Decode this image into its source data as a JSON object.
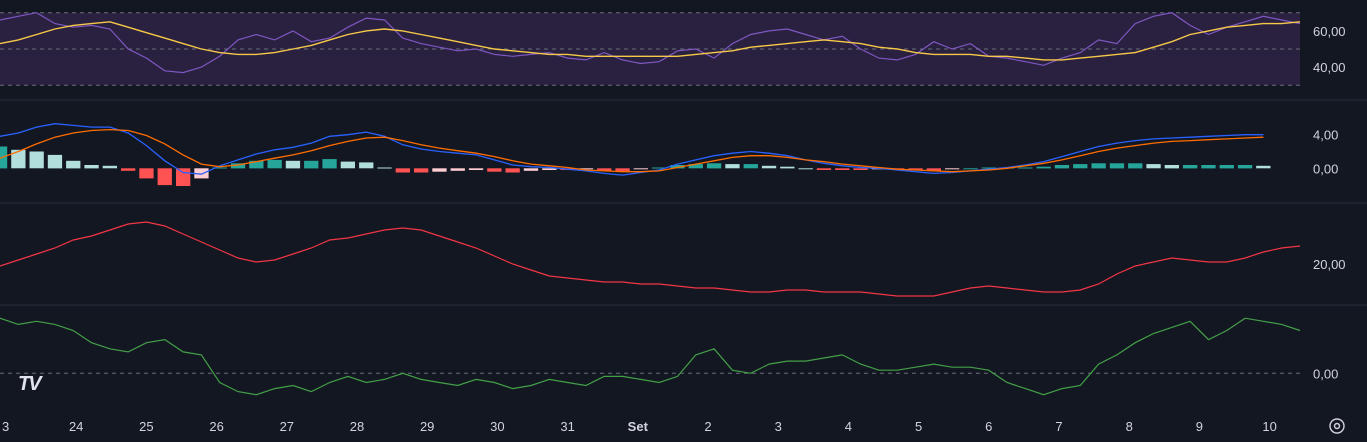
{
  "colors": {
    "background": "#131722",
    "rsi_band": "#2a2140",
    "rsi_line": "#7e57c2",
    "rsi_ma": "#f7c948",
    "macd_line": "#2962ff",
    "signal_line": "#ff6d00",
    "hist_pos_strong": "#26a69a",
    "hist_pos_weak": "#b2dfdb",
    "hist_neg_strong": "#ff5252",
    "hist_neg_weak": "#ffcdd2",
    "adx_line": "#f23645",
    "mom_line": "#43a047",
    "grid": "#1f2330",
    "dashed": "#6b6f7a"
  },
  "logo_text": "TV",
  "settings_icon": "gear-icon",
  "chart_data": [
    {
      "type": "line",
      "panel": "rsi",
      "y_ticks": [
        "60,00",
        "40,00"
      ],
      "ylim": [
        23,
        77
      ],
      "bands": [
        30,
        50,
        70
      ],
      "series": [
        {
          "values": [
            66,
            68,
            70,
            64,
            62,
            63,
            61,
            50,
            45,
            38,
            37,
            40,
            46,
            55,
            58,
            55,
            60,
            54,
            56,
            62,
            67,
            66,
            56,
            53,
            51,
            49,
            50,
            47,
            46,
            47,
            48,
            45,
            44,
            48,
            44,
            42,
            43,
            49,
            50,
            45,
            53,
            58,
            60,
            61,
            58,
            55,
            57,
            50,
            45,
            44,
            47,
            54,
            50,
            53,
            46,
            45,
            43,
            41,
            45,
            48,
            55,
            53,
            64,
            68,
            70,
            63,
            58,
            62,
            65,
            68,
            66,
            64
          ]
        },
        {
          "values": [
            53,
            55,
            58,
            61,
            63,
            64,
            65,
            62,
            59,
            56,
            53,
            50,
            48,
            47,
            47,
            48,
            50,
            52,
            55,
            58,
            60,
            61,
            60,
            58,
            56,
            54,
            52,
            50,
            49,
            48,
            47,
            47,
            46,
            46,
            46,
            46,
            46,
            46,
            47,
            48,
            49,
            51,
            52,
            53,
            54,
            55,
            54,
            53,
            51,
            50,
            48,
            47,
            47,
            47,
            46,
            46,
            45,
            44,
            44,
            45,
            46,
            47,
            48,
            51,
            54,
            58,
            60,
            62,
            63,
            64,
            64,
            65
          ]
        }
      ]
    },
    {
      "type": "bar",
      "panel": "macd",
      "y_ticks": [
        "4,00",
        "0,00"
      ],
      "ylim": [
        -4,
        8
      ],
      "series": [
        {
          "values": [
            3.8,
            4.2,
            4.9,
            5.3,
            5.1,
            4.9,
            4.9,
            4.2,
            2.7,
            0.9,
            -0.5,
            -0.7,
            0.3,
            1.0,
            1.7,
            2.2,
            2.5,
            3.0,
            3.8,
            4.0,
            4.3,
            3.8,
            2.8,
            2.3,
            2.0,
            1.8,
            1.6,
            1.0,
            0.4,
            0.2,
            0.1,
            -0.1,
            -0.3,
            -0.6,
            -0.8,
            -0.5,
            -0.2,
            0.5,
            1.0,
            1.5,
            1.8,
            2.0,
            1.8,
            1.5,
            1.0,
            0.6,
            0.3,
            0.1,
            0.0,
            -0.2,
            -0.4,
            -0.6,
            -0.5,
            -0.3,
            -0.1,
            0.1,
            0.4,
            0.8,
            1.4,
            2.0,
            2.6,
            3.0,
            3.3,
            3.5,
            3.6,
            3.7,
            3.8,
            3.9,
            4.0,
            4.0
          ]
        },
        {
          "values": [
            1.2,
            2.0,
            2.9,
            3.7,
            4.2,
            4.5,
            4.6,
            4.5,
            3.9,
            2.9,
            1.6,
            0.5,
            0.2,
            0.4,
            0.8,
            1.2,
            1.6,
            2.1,
            2.7,
            3.2,
            3.6,
            3.7,
            3.3,
            2.8,
            2.4,
            2.1,
            1.8,
            1.4,
            0.9,
            0.5,
            0.3,
            0.1,
            -0.2,
            -0.3,
            -0.4,
            -0.4,
            -0.3,
            0.1,
            0.5,
            0.9,
            1.3,
            1.5,
            1.5,
            1.3,
            1.0,
            0.8,
            0.5,
            0.3,
            0.1,
            -0.1,
            -0.2,
            -0.3,
            -0.4,
            -0.3,
            -0.2,
            0.0,
            0.3,
            0.6,
            1.0,
            1.5,
            2.0,
            2.4,
            2.7,
            3.0,
            3.2,
            3.3,
            3.4,
            3.5,
            3.6,
            3.7
          ]
        },
        {
          "values": [
            2.6,
            2.2,
            2.0,
            1.6,
            0.9,
            0.4,
            0.3,
            -0.3,
            -1.2,
            -2.0,
            -2.1,
            -1.2,
            0.1,
            0.6,
            0.9,
            1.0,
            0.9,
            0.9,
            1.1,
            0.8,
            0.7,
            0.1,
            -0.5,
            -0.5,
            -0.4,
            -0.3,
            -0.2,
            -0.4,
            -0.5,
            -0.3,
            -0.2,
            -0.2,
            -0.1,
            -0.3,
            -0.4,
            -0.1,
            0.1,
            0.4,
            0.5,
            0.6,
            0.5,
            0.5,
            0.3,
            0.2,
            0.0,
            -0.2,
            -0.2,
            -0.2,
            -0.1,
            -0.1,
            -0.2,
            -0.3,
            -0.1,
            0.0,
            0.1,
            0.1,
            0.1,
            0.2,
            0.4,
            0.5,
            0.6,
            0.6,
            0.6,
            0.5,
            0.4,
            0.4,
            0.4,
            0.4,
            0.4,
            0.3
          ]
        }
      ]
    },
    {
      "type": "line",
      "panel": "adx",
      "y_ticks": [
        "20,00"
      ],
      "ylim": [
        10,
        35
      ],
      "series": [
        {
          "values": [
            19.5,
            21,
            22.5,
            24,
            26,
            27,
            28.5,
            30,
            30.5,
            29.5,
            27.5,
            25.5,
            23.5,
            21.5,
            20.5,
            21,
            22.5,
            24,
            26,
            26.5,
            27.5,
            28.5,
            29,
            28.5,
            27,
            25.5,
            24,
            22,
            20,
            18.5,
            17,
            16.5,
            16,
            15.5,
            15.5,
            15,
            15,
            14.5,
            14,
            14,
            13.5,
            13,
            13,
            13.5,
            13.5,
            13,
            13,
            13,
            12.5,
            12,
            12,
            12,
            13,
            14,
            14.5,
            14,
            13.5,
            13,
            13,
            13.5,
            15,
            17.5,
            19.5,
            20.5,
            21.5,
            21,
            20.5,
            20.5,
            21.5,
            23,
            24,
            24.5
          ]
        }
      ]
    },
    {
      "type": "line",
      "panel": "momentum",
      "y_ticks": [
        "0,00"
      ],
      "ylim": [
        -12,
        22
      ],
      "series": [
        {
          "values": [
            18,
            16,
            17,
            16,
            14,
            10,
            8,
            7,
            10,
            11,
            7,
            6,
            -3,
            -6,
            -7,
            -5,
            -4,
            -6,
            -3,
            -1,
            -3,
            -2,
            0,
            -2,
            -3,
            -4,
            -2,
            -3,
            -5,
            -4,
            -2,
            -3,
            -4,
            -1,
            -1,
            -2,
            -3,
            -1,
            6,
            8,
            1,
            0,
            3,
            4,
            4,
            5,
            6,
            3,
            1,
            1,
            2,
            3,
            2,
            2,
            1,
            -3,
            -5,
            -7,
            -5,
            -4,
            3,
            6,
            10,
            13,
            15,
            17,
            11,
            14,
            18,
            17,
            16,
            14
          ]
        }
      ]
    }
  ],
  "x_axis": {
    "ticks": [
      "3",
      "24",
      "25",
      "26",
      "27",
      "28",
      "29",
      "30",
      "31",
      "Set",
      "2",
      "3",
      "4",
      "5",
      "6",
      "7",
      "8",
      "9",
      "10"
    ]
  }
}
